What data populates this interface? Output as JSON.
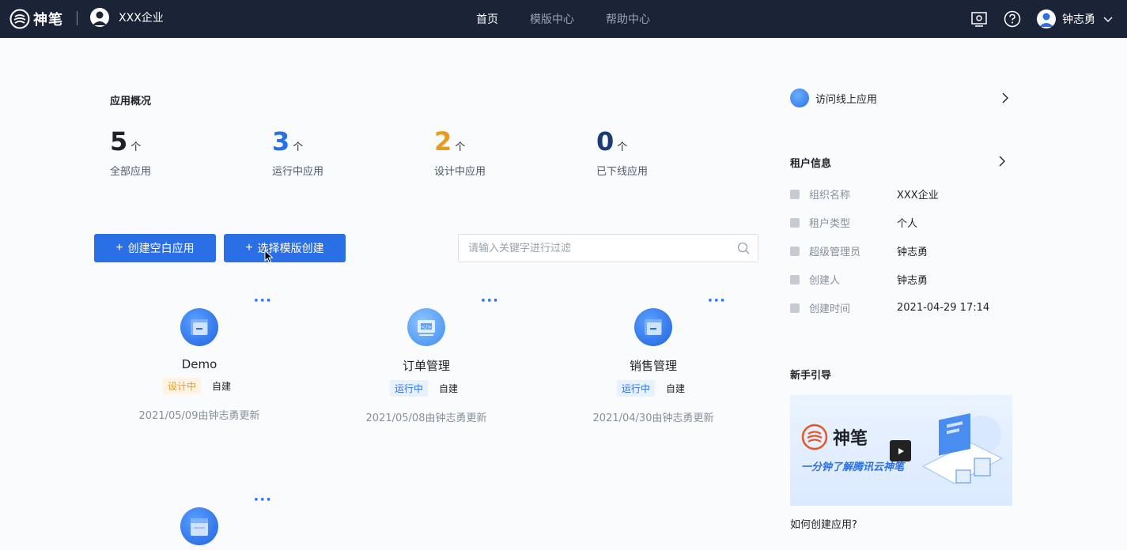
{
  "topbar": {
    "logo_text": "神笔",
    "org_name": "XXX企业",
    "nav": [
      {
        "label": "首页",
        "active": true
      },
      {
        "label": "模版中心",
        "active": false
      },
      {
        "label": "帮助中心",
        "active": false
      }
    ],
    "user_name": "钟志勇"
  },
  "overview": {
    "title": "应用概况",
    "unit": "个",
    "stats": [
      {
        "value": "5",
        "label": "全部应用",
        "color": "#1f2329"
      },
      {
        "value": "3",
        "label": "运行中应用",
        "color": "#2b6fe6"
      },
      {
        "value": "2",
        "label": "设计中应用",
        "color": "#e89b1c"
      },
      {
        "value": "0",
        "label": "已下线应用",
        "color": "#1b3b78"
      }
    ]
  },
  "actions": {
    "create_blank": "创建空白应用",
    "create_from_template": "选择模版创建",
    "search_placeholder": "请输入关键字进行过滤"
  },
  "apps": [
    {
      "name": "Demo",
      "status": "设计中",
      "status_type": "design",
      "source": "自建",
      "updated": "2021/05/09由钟志勇更新"
    },
    {
      "name": "订单管理",
      "status": "运行中",
      "status_type": "running",
      "source": "自建",
      "updated": "2021/05/08由钟志勇更新"
    },
    {
      "name": "销售管理",
      "status": "运行中",
      "status_type": "running",
      "source": "自建",
      "updated": "2021/04/30由钟志勇更新"
    }
  ],
  "right": {
    "visit_label": "访问线上应用",
    "tenant_title": "租户信息",
    "tenant_info": [
      {
        "key": "组织名称",
        "value": "XXX企业"
      },
      {
        "key": "租户类型",
        "value": "个人"
      },
      {
        "key": "超级管理员",
        "value": "钟志勇"
      },
      {
        "key": "创建人",
        "value": "钟志勇"
      },
      {
        "key": "创建时间",
        "value": "2021-04-29 17:14"
      }
    ],
    "guide_title": "新手引导",
    "banner_logo": "神笔",
    "banner_sub": "一分钟了解腾讯云神笔",
    "guide_question": "如何创建应用?"
  }
}
